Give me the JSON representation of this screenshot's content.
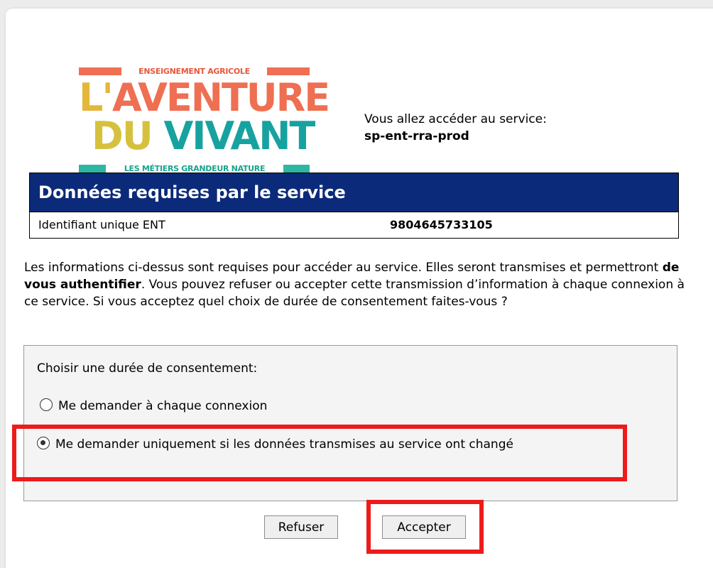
{
  "logo": {
    "tag_top": "ENSEIGNEMENT AGRICOLE",
    "line1_first": "L'",
    "line1_rest": "AVENTURE",
    "line2_first": "DU",
    "line2_rest": "VIVANT",
    "tag_bottom": "LES MÉTIERS GRANDEUR NATURE"
  },
  "service": {
    "intro": "Vous allez accéder au service:",
    "name": "sp-ent-rra-prod"
  },
  "required_data": {
    "title": "Données requises par le service",
    "rows": [
      {
        "key": "Identifiant unique ENT",
        "value": "9804645733105"
      }
    ]
  },
  "explanation": {
    "part1": "Les informations ci-dessus sont requises pour accéder au service. Elles seront transmises et permettront ",
    "bold": "de vous authentifier",
    "part2": ". Vous pouvez refuser ou accepter cette transmission d’information à chaque connexion à ce service. Si vous acceptez quel choix de durée de consentement faites-vous ?"
  },
  "consent": {
    "title": "Choisir une durée de consentement:",
    "options": [
      {
        "label": "Me demander à chaque connexion",
        "checked": false
      },
      {
        "label": "Me demander uniquement si les données transmises au service ont changé",
        "checked": true
      }
    ]
  },
  "buttons": {
    "refuse": "Refuser",
    "accept": "Accepter"
  },
  "colors": {
    "table_header": "#0c2a7a",
    "highlight": "#ee1b1b"
  }
}
